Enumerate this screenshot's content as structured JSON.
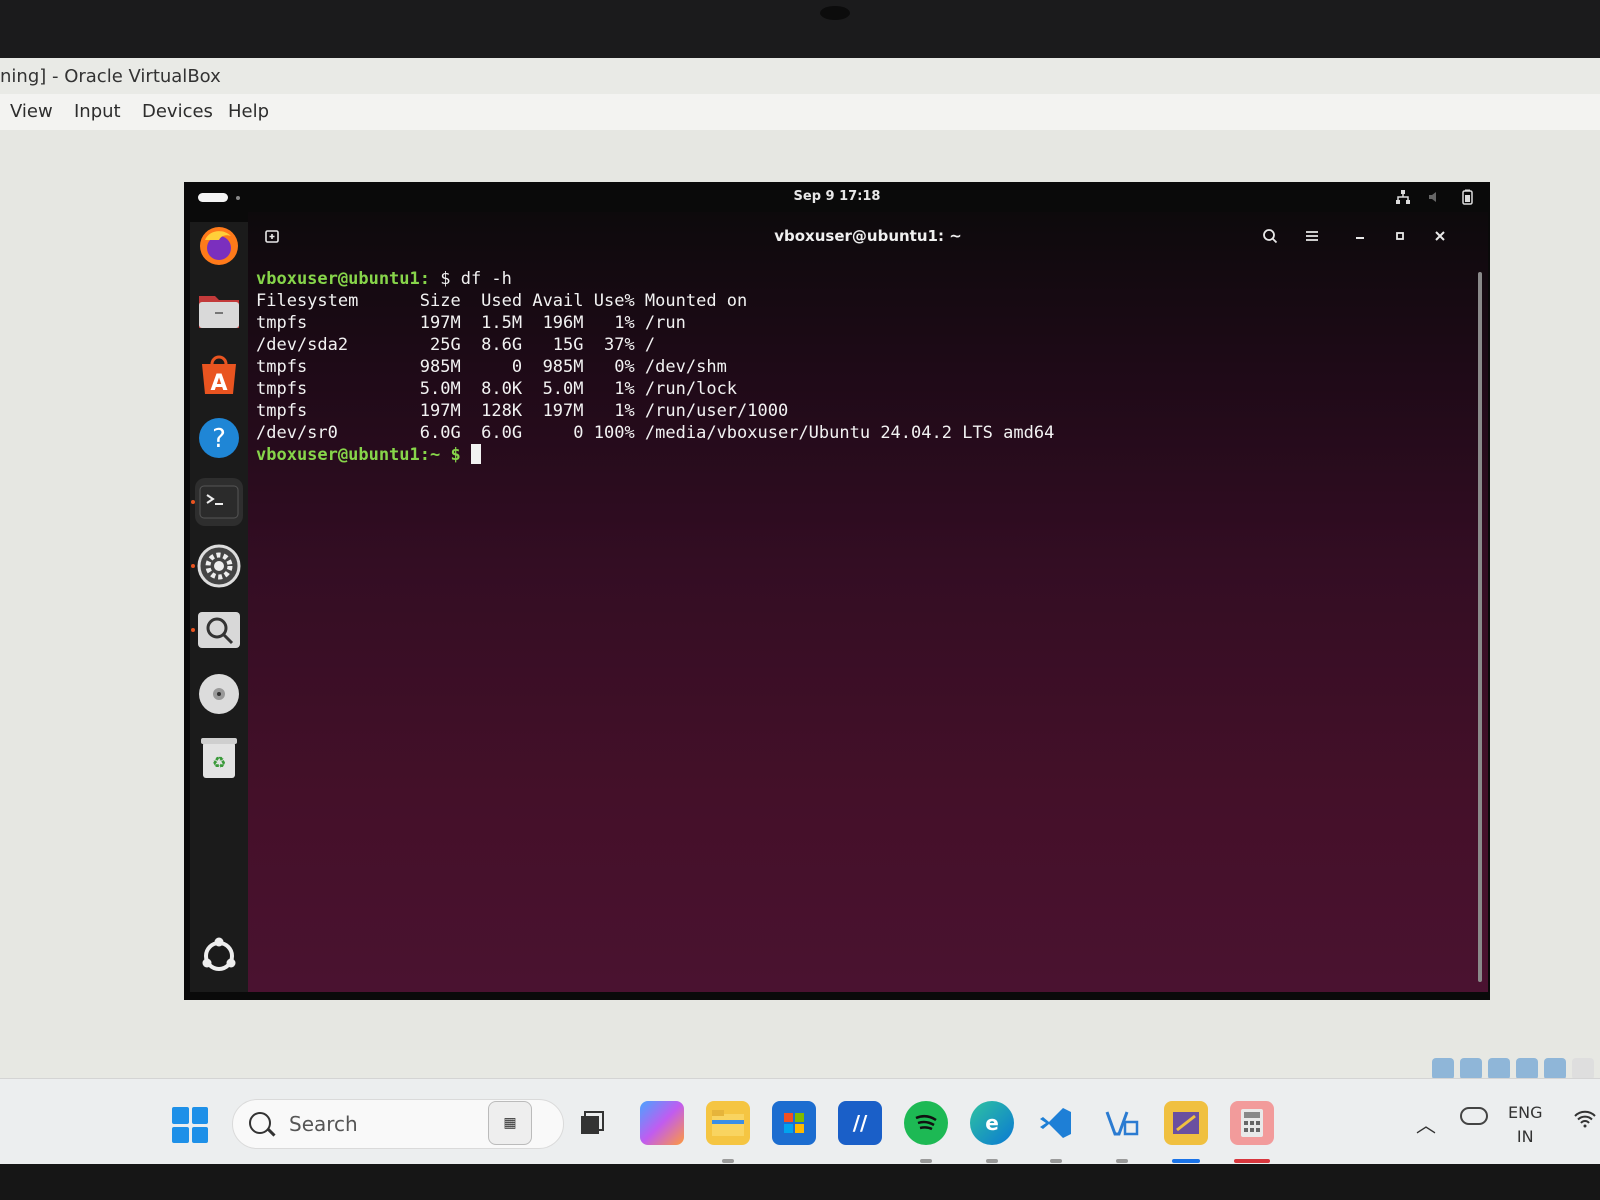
{
  "vbox": {
    "title": "ning] - Oracle VirtualBox",
    "menu": [
      {
        "label": "View"
      },
      {
        "label": "Input"
      },
      {
        "label": "Devices"
      },
      {
        "label": "Help"
      }
    ]
  },
  "ubuntu": {
    "clock": "Sep 9  17:18",
    "dock": [
      {
        "name": "firefox-icon"
      },
      {
        "name": "files-icon"
      },
      {
        "name": "app-center-icon"
      },
      {
        "name": "help-icon"
      },
      {
        "name": "terminal-icon"
      },
      {
        "name": "settings-icon"
      },
      {
        "name": "image-viewer-icon"
      },
      {
        "name": "disc-icon"
      },
      {
        "name": "trash-icon"
      },
      {
        "name": "show-apps-icon"
      }
    ]
  },
  "terminal": {
    "title": "vboxuser@ubuntu1: ~",
    "prompt": "vboxuser@ubuntu1:",
    "command": "$ df -h",
    "prompt2": "vboxuser@ubuntu1:",
    "prompt2_suffix": "~ $ ",
    "header": "Filesystem      Size  Used Avail Use% Mounted on",
    "rows": [
      "tmpfs           197M  1.5M  196M   1% /run",
      "/dev/sda2        25G  8.6G   15G  37% /",
      "tmpfs           985M     0  985M   0% /dev/shm",
      "tmpfs           5.0M  8.0K  5.0M   1% /run/lock",
      "tmpfs           197M  128K  197M   1% /run/user/1000",
      "/dev/sr0        6.0G  6.0G     0 100% /media/vboxuser/Ubuntu 24.04.2 LTS amd64"
    ]
  },
  "taskbar": {
    "search_placeholder": "Search",
    "lang_line1": "ENG",
    "lang_line2": "IN"
  },
  "colors": {
    "prompt_green": "#87d54a",
    "terminal_bg": "#441029",
    "ubuntu_orange": "#e95420"
  }
}
